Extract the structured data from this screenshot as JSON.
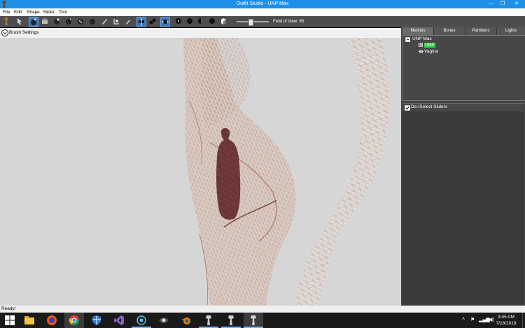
{
  "window": {
    "title": "Outfit Studio - UNP Max",
    "controls": {
      "minimize": "—",
      "maximize": "❐",
      "close": "✕"
    }
  },
  "menubar": {
    "items": [
      "File",
      "Edit",
      "Shape",
      "Slider",
      "Tool"
    ]
  },
  "toolbar": {
    "tools": [
      "pose-tool",
      "select-tool",
      "brush-tool",
      "inflate-tool",
      "deflate-tool",
      "move-tool",
      "smooth-tool",
      "undiff-tool",
      "edit-brush-tool",
      "weight-tool",
      "color-tool",
      "mirror-x-toggle",
      "connected-only-toggle",
      "global-brush-toggle",
      "view-front",
      "view-left",
      "view-right",
      "view-back",
      "view-light"
    ],
    "field_of_view_label": "Field of View: 65",
    "field_of_view_value": 65
  },
  "brush_settings": {
    "label": "Brush Settings"
  },
  "right_panel": {
    "tabs": [
      "Meshes",
      "Bones",
      "Partitions",
      "Lights"
    ],
    "active_tab": "Meshes",
    "tree": {
      "root": "UNP Max",
      "children": [
        "UNP",
        "Vagina"
      ]
    },
    "sliders_header": "De-/Select Sliders"
  },
  "status": {
    "text": "Ready!"
  },
  "taskbar": {
    "apps": [
      "windows-start-icon",
      "file-explorer-icon",
      "firefox-icon",
      "chrome-icon",
      "defender-icon",
      "visual-studio-icon",
      "camera-icon",
      "eye-app-icon",
      "blender-icon",
      "outfit-studio-icon-1",
      "outfit-studio-icon-2",
      "outfit-studio-icon-3"
    ],
    "time": "3:45 AM",
    "date": "7/18/2018"
  },
  "colors": {
    "title_bar": "#1e90e8",
    "toolbar": "#4d4d4d",
    "viewport": "#d6d6d6",
    "mesh_wire": "#c98a6c",
    "selected_mesh_chip": "#2ecc40",
    "panel": "#444444"
  }
}
